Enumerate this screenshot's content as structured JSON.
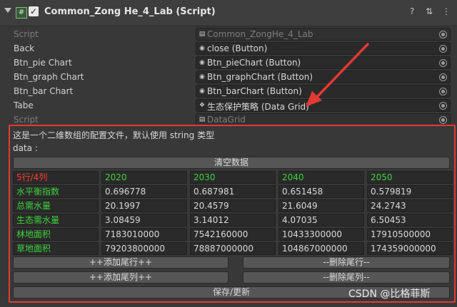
{
  "header": {
    "title": "Common_Zong He_4_Lab (Script)"
  },
  "properties": [
    {
      "label": "Script",
      "value": "Common_ZongHe_4_Lab",
      "icon": "script-icon",
      "dim": true
    },
    {
      "label": "Back",
      "value": "close (Button)",
      "icon": "button-object-icon",
      "dim": false
    },
    {
      "label": "Btn_pie Chart",
      "value": "Btn_pieChart (Button)",
      "icon": "button-object-icon",
      "dim": false
    },
    {
      "label": "Btn_graph Chart",
      "value": "Btn_graphChart (Button)",
      "icon": "button-object-icon",
      "dim": false
    },
    {
      "label": "Btn_bar Chart",
      "value": "Btn_barChart (Button)",
      "icon": "button-object-icon",
      "dim": false
    },
    {
      "label": "Tabe",
      "value": "生态保护策略 (Data Grid)",
      "icon": "datagrid-object-icon",
      "dim": false
    },
    {
      "label": "Script",
      "value": "DataGrid",
      "icon": "script-icon",
      "dim": true
    }
  ],
  "panel": {
    "description": "这是一个二维数组的配置文件，默认使用 string 类型",
    "data_label": "data :",
    "clear_button": "清空数据",
    "grid": {
      "corner": "5行/4列",
      "years": [
        "2020",
        "2030",
        "2040",
        "2050"
      ],
      "rows": [
        {
          "name": "水平衡指数",
          "values": [
            "0.696778",
            "0.687981",
            "0.651458",
            "0.579819"
          ]
        },
        {
          "name": "总需水量",
          "values": [
            "20.1997",
            "20.4579",
            "21.6049",
            "24.2743"
          ]
        },
        {
          "name": "生态需水量",
          "values": [
            "3.08459",
            "3.14012",
            "4.07035",
            "6.50453"
          ]
        },
        {
          "name": "林地面积",
          "values": [
            "7183010000",
            "7542160000",
            "10433300000",
            "17910500000"
          ]
        },
        {
          "name": "草地面积",
          "values": [
            "79203800000",
            "78887000000",
            "104867000000",
            "174359000000"
          ]
        }
      ]
    },
    "add_row_button": "++添加尾行++",
    "delete_row_button": "--删除尾行--",
    "add_col_button": "++添加尾列++",
    "delete_col_button": "--删除尾列--",
    "save_button": "保存/更新"
  },
  "watermark": "CSDN @比格菲斯",
  "colors": {
    "highlight_border": "#e53935",
    "year_text": "#3cd23c",
    "corner_text": "#ff3b30"
  }
}
